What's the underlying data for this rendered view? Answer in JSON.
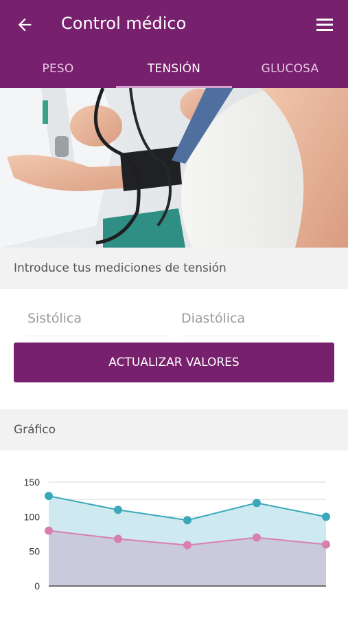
{
  "appbar": {
    "title": "Control médico",
    "back_icon": "arrow-left-icon",
    "menu_icon": "hamburger-menu-icon",
    "color": "#77206d"
  },
  "tabs": [
    {
      "label": "PESO",
      "active": false
    },
    {
      "label": "TENSIÓN",
      "active": true
    },
    {
      "label": "GLUCOSA",
      "active": false
    }
  ],
  "hero": {
    "subject": "blood-pressure-measurement-photo"
  },
  "measure_section": {
    "header": "Introduce tus mediciones de tensión",
    "systolic_placeholder": "Sistólica",
    "diastolic_placeholder": "Diastólica",
    "button_label": "ACTUALIZAR VALORES"
  },
  "chart_section": {
    "header": "Gráfico"
  },
  "chart_data": {
    "type": "area",
    "x": [
      1,
      2,
      3,
      4,
      5
    ],
    "ylim": [
      0,
      150
    ],
    "yticks": [
      0,
      50,
      100,
      150
    ],
    "grid": true,
    "series": [
      {
        "values": [
          130,
          110,
          95,
          120,
          100
        ],
        "color": "#3aa8b8"
      },
      {
        "values": [
          80,
          68,
          59,
          70,
          60
        ],
        "color": "#d97fae"
      }
    ]
  }
}
